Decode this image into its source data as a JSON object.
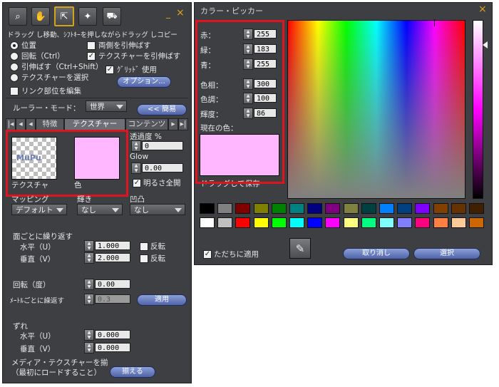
{
  "left_panel": {
    "hint": "ドラッグ し移動、ｼﾌﾄｷｰを押しながらドラッグ しコピー",
    "mode_options": [
      "位置",
      "回転（Ctrl）",
      "引伸ばす（Ctrl+Shift）",
      "テクスチャーを選択"
    ],
    "mode_selected": 0,
    "check_stretch_both": "両側を引伸ばす",
    "check_stretch_texture": "テクスチャーを引伸ばす",
    "check_grid": "ｸﾞﾘｯﾄﾞ 使用",
    "options_button": "オプション...",
    "edit_linked": "リンク部位を編集",
    "ruler_label": "ルーラー・モード：",
    "ruler_value": "世界",
    "less_button": "<< 簡易",
    "tabs": [
      "特徴",
      "テクスチャー",
      "コンテンツ"
    ],
    "active_tab": 1,
    "texture_label": "テクスチャ",
    "texture_name": "MuPu",
    "color_label": "色",
    "color_value": "#ffb7ff",
    "transparency_label": "透過度 %",
    "transparency_value": "0",
    "glow_label": "Glow",
    "glow_value": "0.00",
    "full_bright": "明るさ全開",
    "mapping_label": "マッピング",
    "mapping_value": "デフォルト",
    "shiny_label": "輝き",
    "shiny_value": "なし",
    "bump_label": "凹凸",
    "bump_value": "なし",
    "repeats_label": "面ごとに繰り返す",
    "horizontal_label": "水平（U）",
    "horizontal_value": "1.000",
    "vertical_label": "垂直（V）",
    "vertical_value": "2.000",
    "flip_label": "反転",
    "rotation_label": "回転（度）",
    "rotation_value": "0.00",
    "repeats_per_meter_label": "ﾒｰﾄﾙごとに繰返す",
    "repeats_per_meter_value": "0.3",
    "apply_button": "適用",
    "offset_label": "ずれ",
    "offset_u_value": "0.000",
    "offset_v_value": "0.000",
    "media_line1": "メディア・テクスチャーを揃",
    "media_line2": "（最初にロードすること）",
    "align_button": "揃える"
  },
  "picker": {
    "title": "カラー・ピッカー",
    "close": "×",
    "red_label": "赤：",
    "red_value": "255",
    "green_label": "緑：",
    "green_value": "183",
    "blue_label": "青：",
    "blue_value": "255",
    "hue_label": "色相：",
    "hue_value": "300",
    "sat_label": "色調：",
    "sat_value": "100",
    "lum_label": "輝度：",
    "lum_value": "86",
    "current_label": "現在の色：",
    "current_color": "#ffb7ff",
    "drag_hint": "ドラッグして保存",
    "apply_now": "ただちに適用",
    "cancel_button": "取り消し",
    "select_button": "選択",
    "swatches_row1": [
      "#000000",
      "#808080",
      "#800000",
      "#808000",
      "#008000",
      "#008080",
      "#000080",
      "#800080",
      "#808040",
      "#004040",
      "#0080ff",
      "#004080",
      "#8000ff",
      "#804000",
      "#663300",
      "#402000"
    ],
    "swatches_row2": [
      "#ffffff",
      "#c0c0c0",
      "#ff0000",
      "#ffff00",
      "#00ff00",
      "#00ffff",
      "#0000ff",
      "#ff00ff",
      "#ffff80",
      "#00ff80",
      "#80ffff",
      "#8080ff",
      "#ff0080",
      "#ff8040",
      "#ffcc99",
      "#cc6600"
    ]
  }
}
